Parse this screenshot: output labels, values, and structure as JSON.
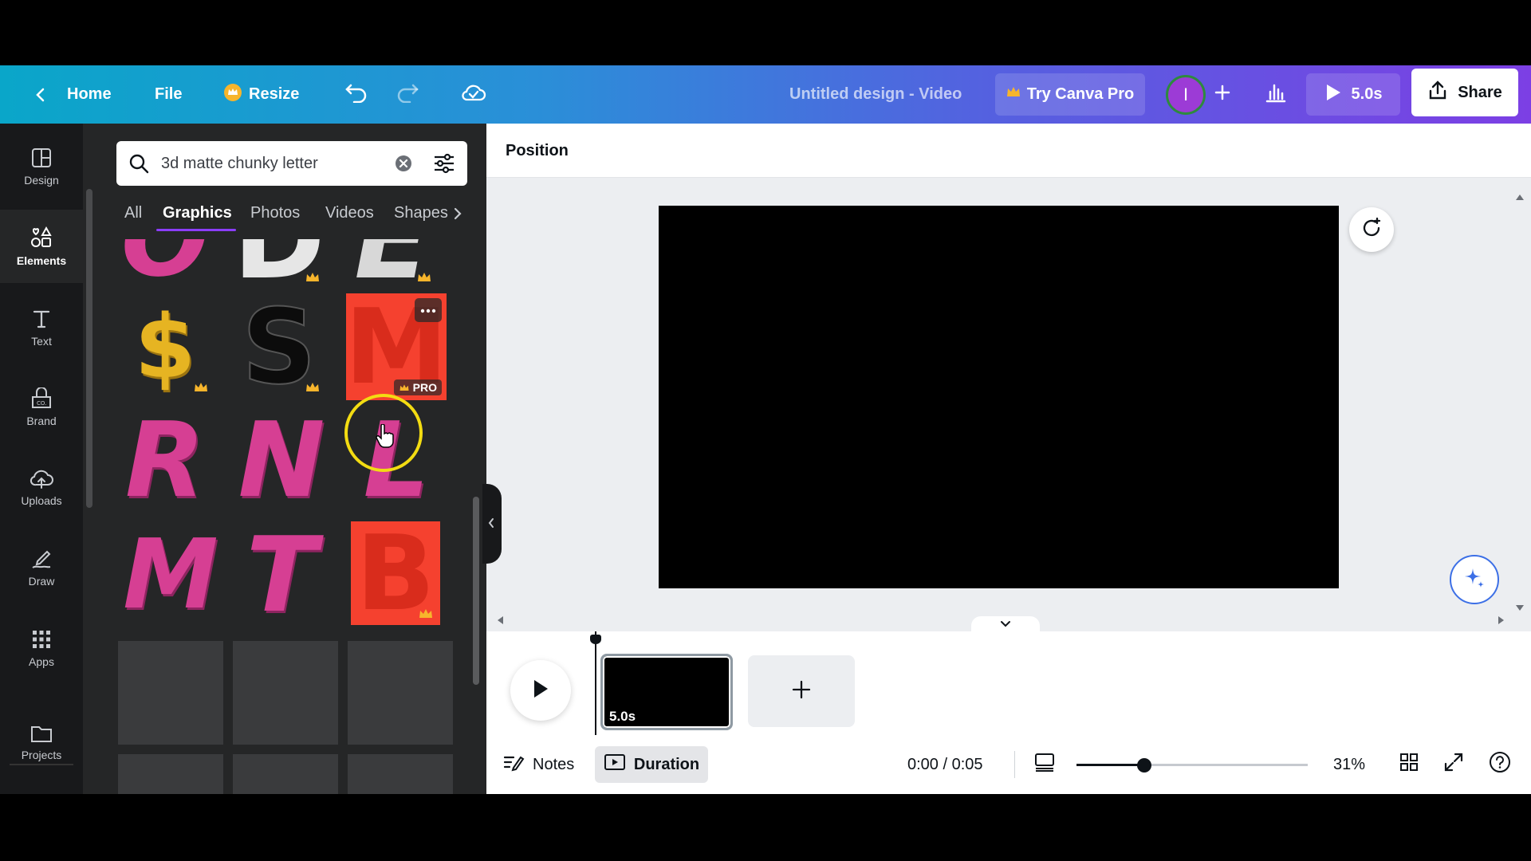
{
  "topbar": {
    "home_label": "Home",
    "file_label": "File",
    "resize_label": "Resize",
    "title": "Untitled design - Video",
    "try_pro_label": "Try Canva Pro",
    "avatar_initial": "I",
    "play_duration": "5.0s",
    "share_label": "Share"
  },
  "rail": {
    "items": [
      {
        "label": "Design",
        "icon": "layout-icon"
      },
      {
        "label": "Elements",
        "icon": "shapes-icon"
      },
      {
        "label": "Text",
        "icon": "text-icon"
      },
      {
        "label": "Brand",
        "icon": "brand-icon"
      },
      {
        "label": "Uploads",
        "icon": "cloud-upload-icon"
      },
      {
        "label": "Draw",
        "icon": "draw-icon"
      },
      {
        "label": "Apps",
        "icon": "apps-grid-icon"
      },
      {
        "label": "Projects",
        "icon": "folder-icon"
      }
    ],
    "active": "Elements"
  },
  "panel": {
    "search_value": "3d matte chunky letter",
    "tabs": [
      "All",
      "Graphics",
      "Photos",
      "Videos",
      "Shapes"
    ],
    "active_tab": "Graphics",
    "pro_badge": "PRO",
    "letters_row3": [
      "R",
      "N",
      "L"
    ],
    "letters_row4": [
      "M",
      "T",
      "B"
    ],
    "letters_row2": [
      "$",
      "S",
      "M"
    ],
    "letters_row1": [
      "O",
      "D",
      "E"
    ]
  },
  "editor": {
    "position_label": "Position"
  },
  "timeline": {
    "clip_duration": "5.0s"
  },
  "footer": {
    "notes_label": "Notes",
    "duration_label": "Duration",
    "time": "0:00 / 0:05",
    "zoom": "31%"
  },
  "colors": {
    "accent_purple": "#8b3dff",
    "pink_letter": "#d63f93",
    "red_letter": "#f5412f",
    "gold_letter": "#e6b422"
  }
}
